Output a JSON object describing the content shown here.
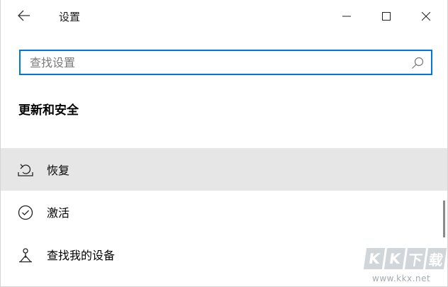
{
  "window": {
    "title": "设置",
    "back_icon": "back-arrow-icon",
    "controls": [
      "minimize-icon",
      "maximize-icon",
      "close-icon"
    ]
  },
  "search": {
    "placeholder": "查找设置",
    "value": "",
    "icon": "search-icon"
  },
  "section": {
    "title": "更新和安全"
  },
  "nav": {
    "items": [
      {
        "label": "恢复",
        "icon": "recovery-icon",
        "selected": true
      },
      {
        "label": "激活",
        "icon": "activation-icon",
        "selected": false
      },
      {
        "label": "查找我的设备",
        "icon": "find-device-icon",
        "selected": false
      }
    ]
  },
  "watermark": {
    "tiles": [
      "K",
      "K",
      "下",
      "载"
    ],
    "url": "www.kkx.net"
  },
  "colors": {
    "accent": "#0078d7",
    "selected_bg": "#e6e6e6"
  }
}
